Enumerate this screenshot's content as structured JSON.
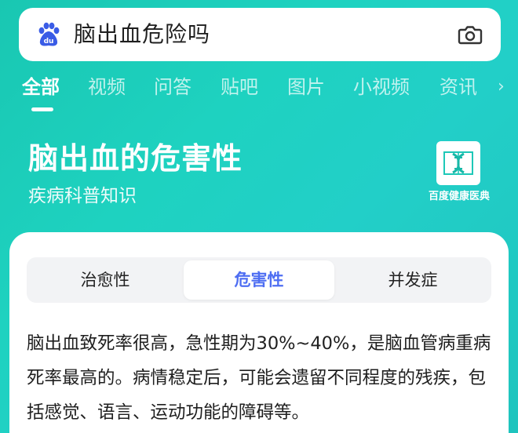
{
  "search": {
    "query": "脑出血危险吗",
    "logo_icon": "baidu-paw-icon",
    "camera_icon": "camera-icon"
  },
  "tabs": [
    {
      "label": "全部",
      "active": true
    },
    {
      "label": "视频",
      "active": false
    },
    {
      "label": "问答",
      "active": false
    },
    {
      "label": "贴吧",
      "active": false
    },
    {
      "label": "图片",
      "active": false
    },
    {
      "label": "小视频",
      "active": false
    },
    {
      "label": "资讯",
      "active": false
    }
  ],
  "knowledge": {
    "title": "脑出血的危害性",
    "subtitle": "疾病科普知识",
    "brand_label": "百度健康医典",
    "brand_icon": "dna-book-icon"
  },
  "segment": {
    "items": [
      {
        "label": "治愈性",
        "active": false
      },
      {
        "label": "危害性",
        "active": true
      },
      {
        "label": "并发症",
        "active": false
      }
    ]
  },
  "content": {
    "description": "脑出血致死率很高，急性期为30%~40%，是脑血管病重病死率最高的。病情稳定后，可能会遗留不同程度的残疾，包括感觉、语言、运动功能的障碍等。"
  },
  "colors": {
    "background": "#1ed2c0",
    "accent": "#4e6ef2",
    "card": "#ffffff"
  }
}
